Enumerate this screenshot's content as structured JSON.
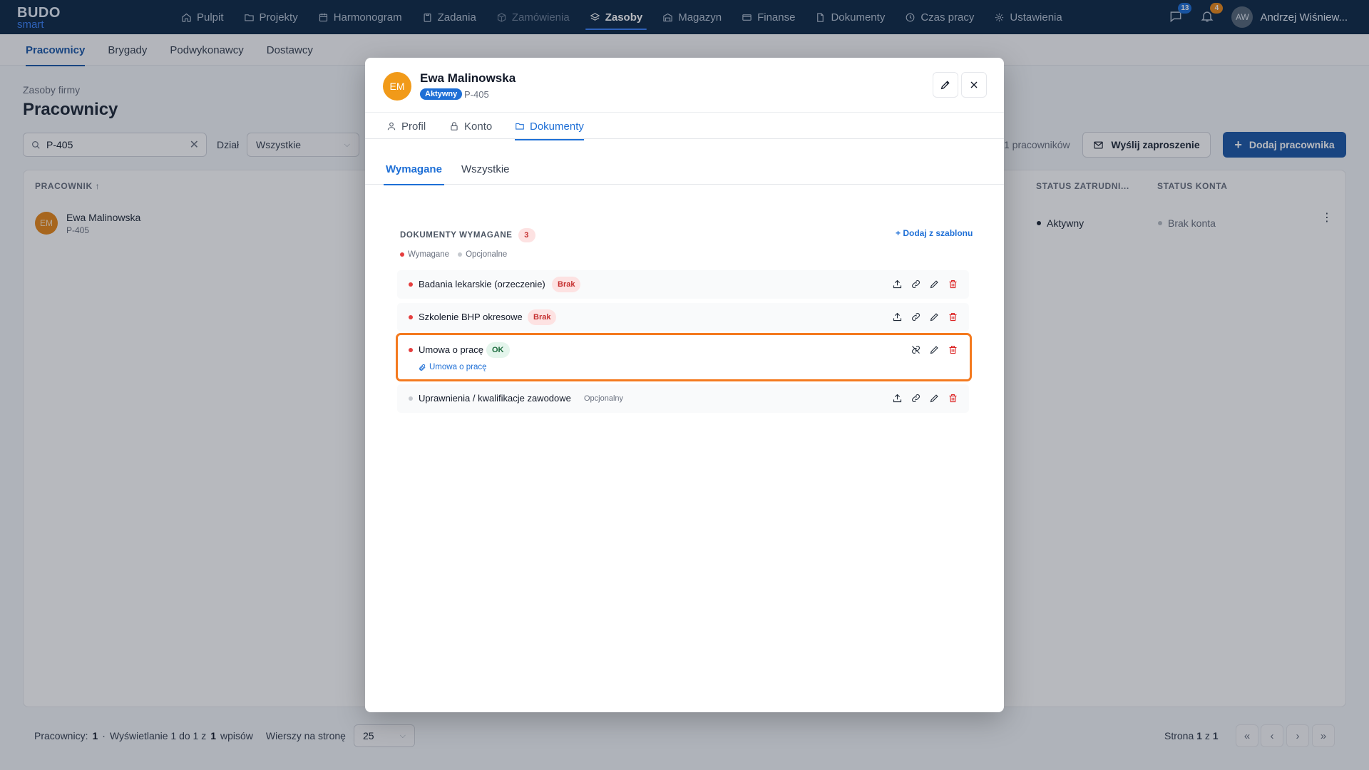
{
  "app": {
    "logo_top": "BUDO",
    "logo_bottom": "smart",
    "nav": [
      {
        "label": "Pulpit",
        "icon": "home-icon"
      },
      {
        "label": "Projekty",
        "icon": "folder-icon"
      },
      {
        "label": "Harmonogram",
        "icon": "calendar-icon"
      },
      {
        "label": "Zadania",
        "icon": "clipboard-icon"
      },
      {
        "label": "Zamówienia",
        "icon": "package-icon"
      },
      {
        "label": "Zasoby",
        "icon": "layers-icon"
      },
      {
        "label": "Magazyn",
        "icon": "warehouse-icon"
      },
      {
        "label": "Finanse",
        "icon": "card-icon"
      },
      {
        "label": "Dokumenty",
        "icon": "file-icon"
      },
      {
        "label": "Czas pracy",
        "icon": "clock-icon"
      },
      {
        "label": "Ustawienia",
        "icon": "gear-icon"
      }
    ],
    "messages_count": "13",
    "notifications_count": "4",
    "user_initials": "AW",
    "user_name": "Andrzej Wiśniew...",
    "colors": {
      "nav_bg": "#0f2a47",
      "accent": "#1e6fd6",
      "primary_btn": "#1e5aa8",
      "highlight": "#f47a1f"
    }
  },
  "subtabs": [
    "Pracownicy",
    "Brygady",
    "Podwykonawcy",
    "Dostawcy"
  ],
  "page": {
    "breadcrumb": "Zasoby firmy",
    "title": "Pracownicy",
    "search_value": "P-405",
    "filter_label": "Dział",
    "filter_value": "Wszystkie",
    "count_text": "1 pracowników",
    "invite_button": "Wyślij zaproszenie",
    "add_button": "Dodaj pracownika"
  },
  "table": {
    "headers": {
      "employee": "PRACOWNIK ↑",
      "employment_status": "STATUS ZATRUDNI...",
      "account_status": "STATUS KONTA"
    },
    "rows": [
      {
        "initials": "EM",
        "name": "Ewa Malinowska",
        "code": "P-405",
        "employment_status": "Aktywny",
        "account_status": "Brak konta"
      }
    ]
  },
  "footer": {
    "employees_label": "Pracownicy:",
    "employees_count": "1",
    "sep": "·",
    "showing_pre": "Wyświetlanie 1 do 1 z",
    "showing_total": "1",
    "showing_post": "wpisów",
    "rows_per_page_label": "Wierszy na stronę",
    "rows_per_page": "25",
    "page_pre": "Strona",
    "page_current": "1",
    "page_mid": "z",
    "page_total": "1"
  },
  "modal": {
    "initials": "EM",
    "name": "Ewa Malinowska",
    "status": "Aktywny",
    "code": "P-405",
    "tabs": [
      {
        "label": "Profil",
        "icon": "user-icon"
      },
      {
        "label": "Konto",
        "icon": "lock-icon"
      },
      {
        "label": "Dokumenty",
        "icon": "folder-icon"
      }
    ],
    "subtabs": [
      "Wymagane",
      "Wszystkie"
    ],
    "section_title": "DOKUMENTY WYMAGANE",
    "section_count": "3",
    "add_from_template": "+ Dodaj z szablonu",
    "legend_required": "Wymagane",
    "legend_optional": "Opcjonalne",
    "documents": [
      {
        "title": "Badania lekarskie (orzeczenie)",
        "status": "Brak",
        "required": true
      },
      {
        "title": "Szkolenie BHP okresowe",
        "status": "Brak",
        "required": true
      },
      {
        "title": "Umowa o pracę",
        "status": "OK",
        "required": true,
        "attachment": "Umowa o pracę"
      },
      {
        "title": "Uprawnienia / kwalifikacje zawodowe",
        "status": "Opcjonalny",
        "required": false
      }
    ]
  }
}
